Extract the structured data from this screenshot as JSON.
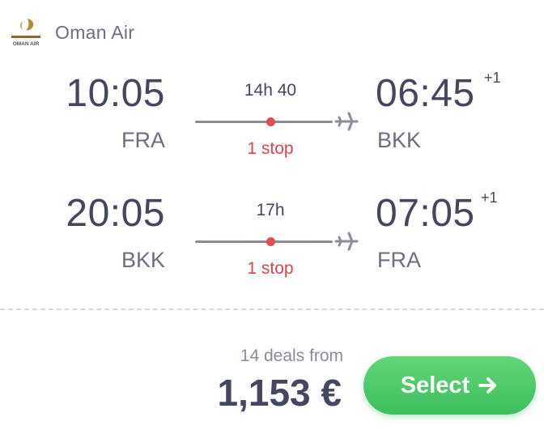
{
  "airline": {
    "name": "Oman Air",
    "logo_text": "OMAN AIR",
    "icon": "oman-air-logo"
  },
  "legs": [
    {
      "departure_time": "10:05",
      "departure_code": "FRA",
      "duration": "14h 40",
      "stops": "1 stop",
      "arrival_time": "06:45",
      "arrival_code": "BKK",
      "day_offset": "+1"
    },
    {
      "departure_time": "20:05",
      "departure_code": "BKK",
      "duration": "17h",
      "stops": "1 stop",
      "arrival_time": "07:05",
      "arrival_code": "FRA",
      "day_offset": "+1"
    }
  ],
  "pricing": {
    "deals_text": "14 deals from",
    "price": "1,153 €"
  },
  "select_button": {
    "label": "Select",
    "icon": "arrow-right-icon"
  },
  "colors": {
    "accent_green": "#4cca69",
    "stop_red": "#e05050",
    "text_dark": "#454761",
    "text_muted": "#8b8c99"
  }
}
